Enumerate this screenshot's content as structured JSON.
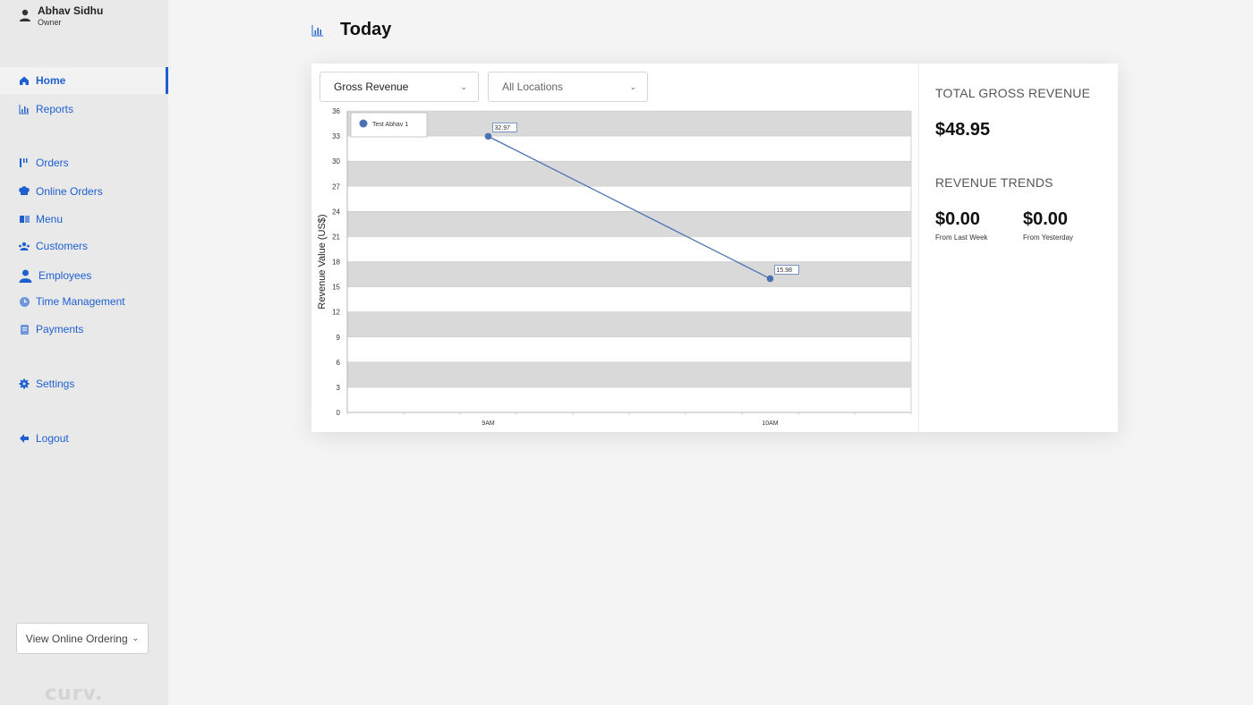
{
  "user": {
    "name": "Abhav Sidhu",
    "role": "Owner"
  },
  "nav": {
    "home": "Home",
    "reports": "Reports",
    "orders": "Orders",
    "online_orders": "Online Orders",
    "menu": "Menu",
    "customers": "Customers",
    "employees": "Employees",
    "time_management": "Time Management",
    "payments": "Payments",
    "settings": "Settings",
    "logout": "Logout"
  },
  "view_online_ordering": "View Online Ordering",
  "logo_text": "curv.",
  "page_title": "Today",
  "filters": {
    "metric": "Gross Revenue",
    "location": "All Locations"
  },
  "stats": {
    "total_label": "TOTAL GROSS REVENUE",
    "total_value": "$48.95",
    "trends_label": "REVENUE TRENDS",
    "last_week_value": "$0.00",
    "last_week_label": "From Last Week",
    "yesterday_value": "$0.00",
    "yesterday_label": "From Yesterday"
  },
  "colors": {
    "accent": "#1e5fd0",
    "series": "#4a72b0",
    "band": "#d9d9d9"
  },
  "chart_data": {
    "type": "line",
    "title": "",
    "xlabel": "",
    "ylabel": "Revenue Value (US$)",
    "categories": [
      "9AM",
      "10AM"
    ],
    "series": [
      {
        "name": "Test Abhav 1",
        "values": [
          32.97,
          15.98
        ],
        "labels": [
          "32.97",
          "15.98"
        ]
      }
    ],
    "ylim": [
      0,
      36
    ],
    "yticks": [
      "0",
      "3",
      "6",
      "9",
      "12",
      "15",
      "18",
      "21",
      "24",
      "27",
      "30",
      "33",
      "36"
    ],
    "grid": true,
    "legend": "top-left"
  }
}
